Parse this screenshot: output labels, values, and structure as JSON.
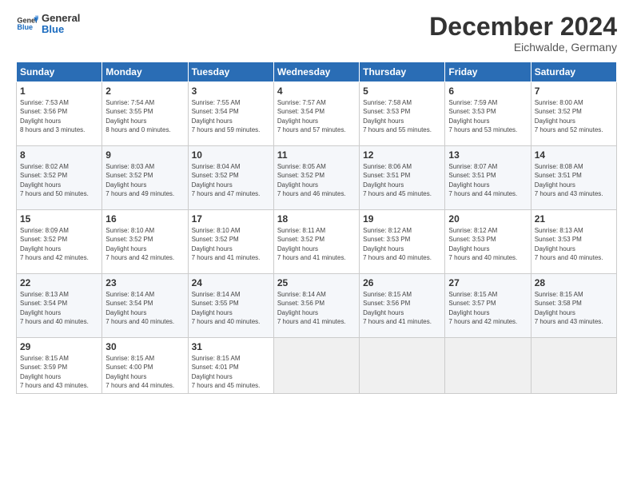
{
  "logo": {
    "line1": "General",
    "line2": "Blue"
  },
  "header": {
    "title": "December 2024",
    "location": "Eichwalde, Germany"
  },
  "weekdays": [
    "Sunday",
    "Monday",
    "Tuesday",
    "Wednesday",
    "Thursday",
    "Friday",
    "Saturday"
  ],
  "weeks": [
    [
      {
        "day": "1",
        "rise": "7:53 AM",
        "set": "3:56 PM",
        "daylight": "8 hours and 3 minutes."
      },
      {
        "day": "2",
        "rise": "7:54 AM",
        "set": "3:55 PM",
        "daylight": "8 hours and 0 minutes."
      },
      {
        "day": "3",
        "rise": "7:55 AM",
        "set": "3:54 PM",
        "daylight": "7 hours and 59 minutes."
      },
      {
        "day": "4",
        "rise": "7:57 AM",
        "set": "3:54 PM",
        "daylight": "7 hours and 57 minutes."
      },
      {
        "day": "5",
        "rise": "7:58 AM",
        "set": "3:53 PM",
        "daylight": "7 hours and 55 minutes."
      },
      {
        "day": "6",
        "rise": "7:59 AM",
        "set": "3:53 PM",
        "daylight": "7 hours and 53 minutes."
      },
      {
        "day": "7",
        "rise": "8:00 AM",
        "set": "3:52 PM",
        "daylight": "7 hours and 52 minutes."
      }
    ],
    [
      {
        "day": "8",
        "rise": "8:02 AM",
        "set": "3:52 PM",
        "daylight": "7 hours and 50 minutes."
      },
      {
        "day": "9",
        "rise": "8:03 AM",
        "set": "3:52 PM",
        "daylight": "7 hours and 49 minutes."
      },
      {
        "day": "10",
        "rise": "8:04 AM",
        "set": "3:52 PM",
        "daylight": "7 hours and 47 minutes."
      },
      {
        "day": "11",
        "rise": "8:05 AM",
        "set": "3:52 PM",
        "daylight": "7 hours and 46 minutes."
      },
      {
        "day": "12",
        "rise": "8:06 AM",
        "set": "3:51 PM",
        "daylight": "7 hours and 45 minutes."
      },
      {
        "day": "13",
        "rise": "8:07 AM",
        "set": "3:51 PM",
        "daylight": "7 hours and 44 minutes."
      },
      {
        "day": "14",
        "rise": "8:08 AM",
        "set": "3:51 PM",
        "daylight": "7 hours and 43 minutes."
      }
    ],
    [
      {
        "day": "15",
        "rise": "8:09 AM",
        "set": "3:52 PM",
        "daylight": "7 hours and 42 minutes."
      },
      {
        "day": "16",
        "rise": "8:10 AM",
        "set": "3:52 PM",
        "daylight": "7 hours and 42 minutes."
      },
      {
        "day": "17",
        "rise": "8:10 AM",
        "set": "3:52 PM",
        "daylight": "7 hours and 41 minutes."
      },
      {
        "day": "18",
        "rise": "8:11 AM",
        "set": "3:52 PM",
        "daylight": "7 hours and 41 minutes."
      },
      {
        "day": "19",
        "rise": "8:12 AM",
        "set": "3:53 PM",
        "daylight": "7 hours and 40 minutes."
      },
      {
        "day": "20",
        "rise": "8:12 AM",
        "set": "3:53 PM",
        "daylight": "7 hours and 40 minutes."
      },
      {
        "day": "21",
        "rise": "8:13 AM",
        "set": "3:53 PM",
        "daylight": "7 hours and 40 minutes."
      }
    ],
    [
      {
        "day": "22",
        "rise": "8:13 AM",
        "set": "3:54 PM",
        "daylight": "7 hours and 40 minutes."
      },
      {
        "day": "23",
        "rise": "8:14 AM",
        "set": "3:54 PM",
        "daylight": "7 hours and 40 minutes."
      },
      {
        "day": "24",
        "rise": "8:14 AM",
        "set": "3:55 PM",
        "daylight": "7 hours and 40 minutes."
      },
      {
        "day": "25",
        "rise": "8:14 AM",
        "set": "3:56 PM",
        "daylight": "7 hours and 41 minutes."
      },
      {
        "day": "26",
        "rise": "8:15 AM",
        "set": "3:56 PM",
        "daylight": "7 hours and 41 minutes."
      },
      {
        "day": "27",
        "rise": "8:15 AM",
        "set": "3:57 PM",
        "daylight": "7 hours and 42 minutes."
      },
      {
        "day": "28",
        "rise": "8:15 AM",
        "set": "3:58 PM",
        "daylight": "7 hours and 43 minutes."
      }
    ],
    [
      {
        "day": "29",
        "rise": "8:15 AM",
        "set": "3:59 PM",
        "daylight": "7 hours and 43 minutes."
      },
      {
        "day": "30",
        "rise": "8:15 AM",
        "set": "4:00 PM",
        "daylight": "7 hours and 44 minutes."
      },
      {
        "day": "31",
        "rise": "8:15 AM",
        "set": "4:01 PM",
        "daylight": "7 hours and 45 minutes."
      },
      null,
      null,
      null,
      null
    ]
  ],
  "labels": {
    "sunrise": "Sunrise:",
    "sunset": "Sunset:",
    "daylight": "Daylight hours"
  }
}
